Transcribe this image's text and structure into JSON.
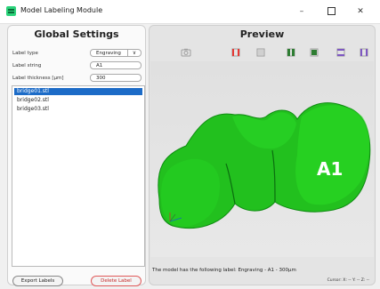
{
  "window": {
    "title": "Model Labeling Module",
    "controls": {
      "minimize": "–",
      "maximize": "",
      "close": "✕"
    }
  },
  "settings": {
    "title": "Global Settings",
    "label_type": {
      "label": "Label type",
      "value": "Engraving"
    },
    "label_string": {
      "label": "Label string",
      "value": "A1"
    },
    "label_thickness": {
      "label": "Label thickness [µm]",
      "value": "300"
    },
    "files": [
      {
        "name": "bridge01.stl",
        "selected": true
      },
      {
        "name": "bridge02.stl",
        "selected": false
      },
      {
        "name": "bridge03.stl",
        "selected": false
      }
    ],
    "export_label": "Export Labels",
    "delete_label": "Delete Label"
  },
  "preview": {
    "title": "Preview",
    "model_label_text": "A1",
    "status": "The model has the following label: Engraving - A1 - 300µm",
    "cursor": "Cursor: X: -- Y: -- Z: --",
    "toolbar_icons": [
      "camera-icon",
      "view-front-icon",
      "view-back-icon",
      "view-left-icon",
      "view-right-icon",
      "view-top-icon",
      "view-bottom-icon"
    ],
    "view_colors": [
      "#e53935",
      "#9e9e9e",
      "#2e7d32",
      "#2e7d32",
      "#7e57c2",
      "#7e57c2"
    ],
    "model_color": "#22c01e"
  }
}
